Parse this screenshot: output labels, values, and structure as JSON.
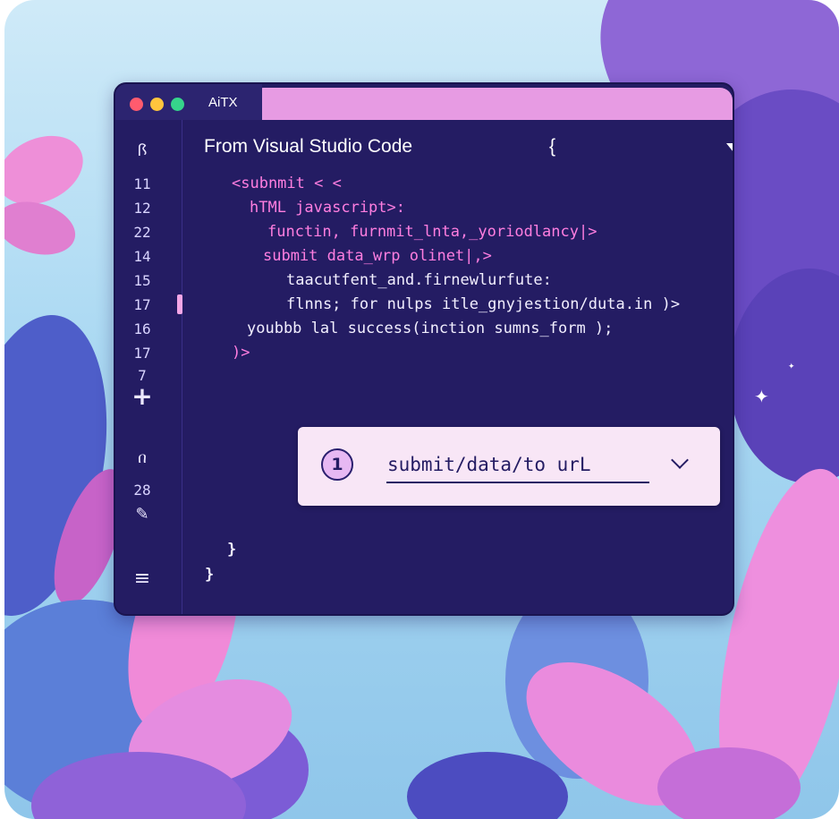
{
  "window": {
    "tab_title": "AiTX",
    "header_title": "From  Visual Studio Code",
    "header_brace": "{"
  },
  "gutter": {
    "line_numbers": [
      "11",
      "12",
      "22",
      "14",
      "15",
      "17",
      "16",
      "17",
      "7",
      "28"
    ],
    "icons": [
      "share-icon",
      "plus-icon",
      "split-icon",
      "pencil-icon",
      "menu-icon"
    ],
    "labels": {
      "top_glyph": "ꟗ",
      "plus": "+",
      "split": "በ",
      "pencil": "✎",
      "menu": "≡"
    }
  },
  "code": {
    "lines": [
      "<subnmit < <",
      "hTML javascript>:",
      "functin, furnmit_lnta,_yoriodlancy|>",
      "submit data_wrp olinet|,>",
      "taacutfent_and.firnewlurfute:",
      "flnns; for nulps itle_gnyjestion/duta.in )>",
      "youbbb lal success(inction sumns_form );",
      ")>",
      "}",
      "}"
    ]
  },
  "suggestion": {
    "number": "1",
    "text": "submit/data/to urL"
  },
  "colors": {
    "editor_bg": "#241c63",
    "tab_accent": "#e79be3",
    "keyword": "#ff7ee0",
    "suggestion_bg": "#f8e6f6"
  }
}
